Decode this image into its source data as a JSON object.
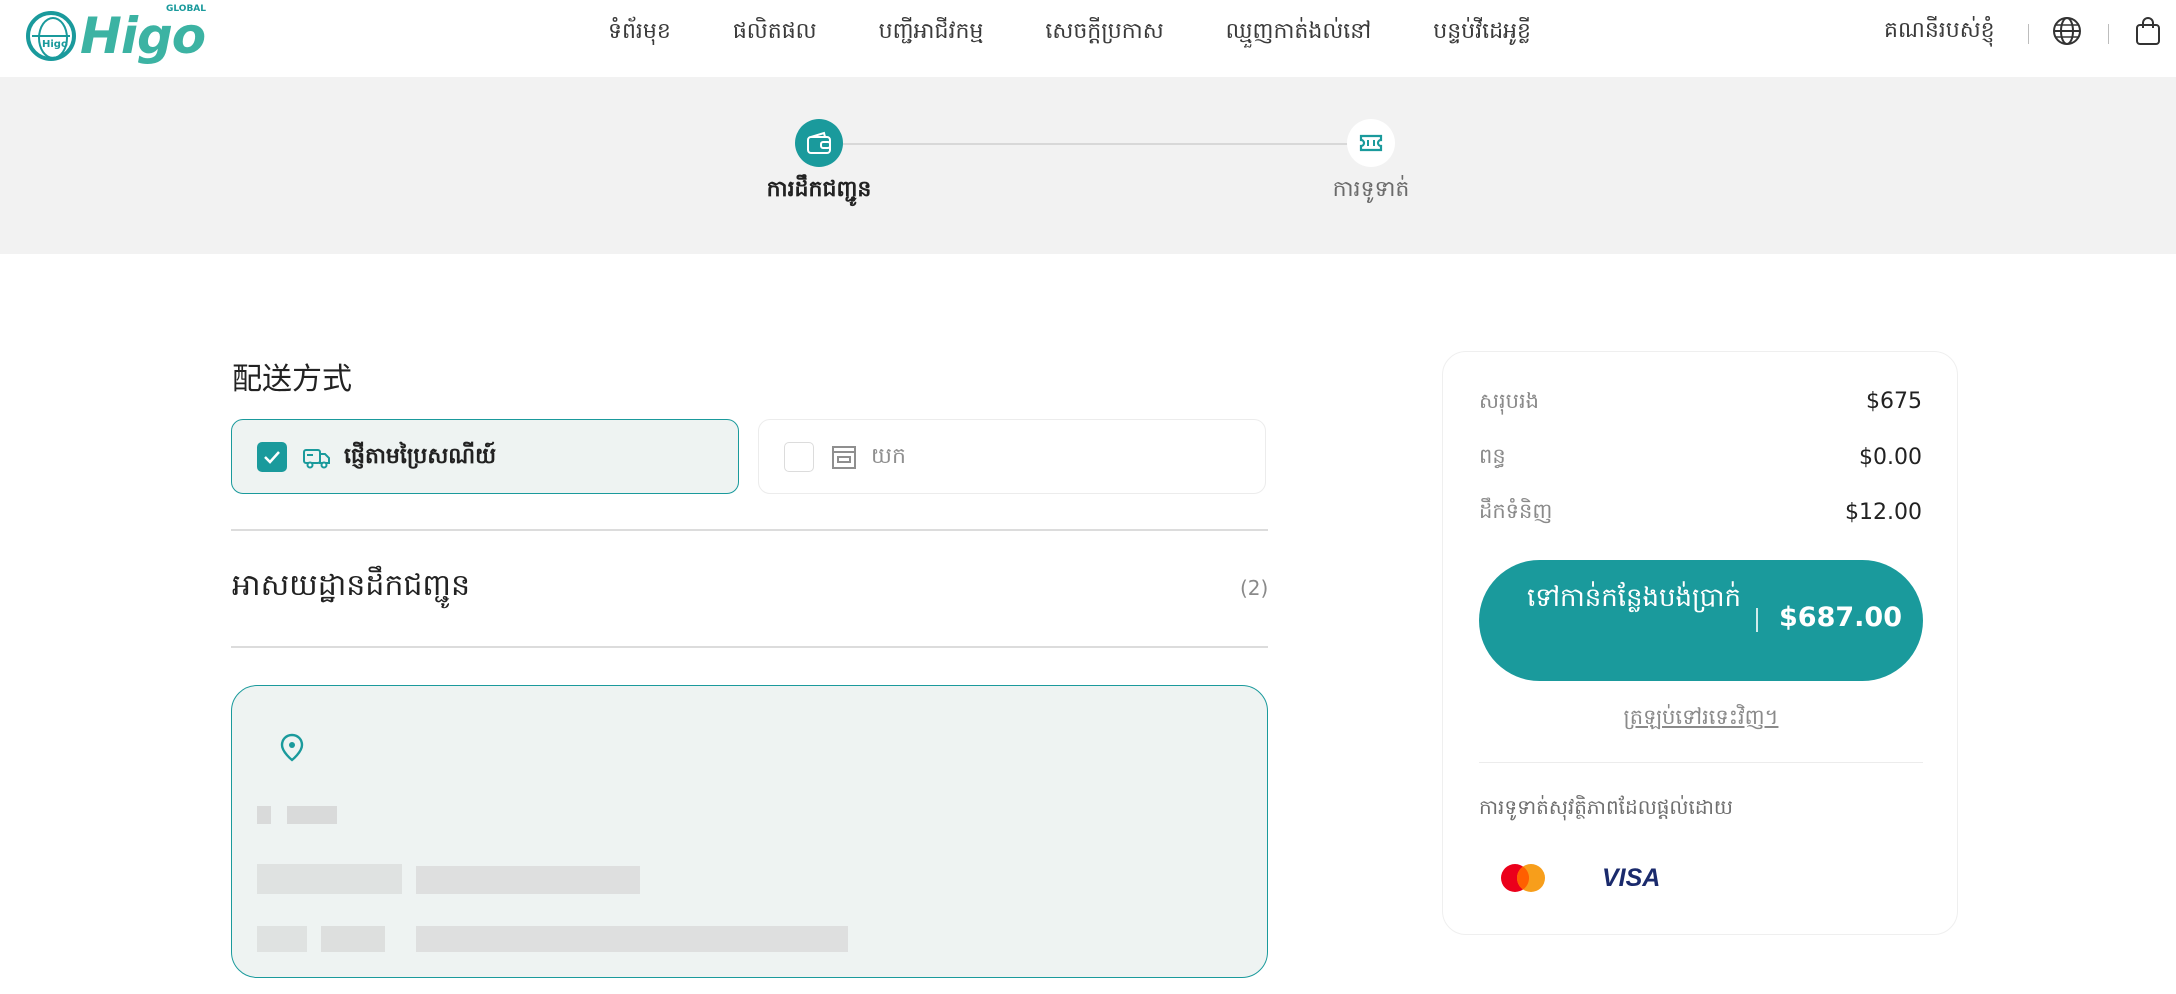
{
  "header": {
    "logo_text": "Higo",
    "logo_sub": "GLOBAL",
    "logo_mark": "Higo",
    "nav": [
      "ទំព័រមុខ",
      "ផលិតផល",
      "បញ្ជីអាជីវកម្ម",
      "សេចក្តីប្រកាស",
      "ឈ្មួញកាត់ងល់នៅ",
      "បន្ទប់វីដេអូខ្លី"
    ],
    "account_label": "គណនីរបស់ខ្ញុំ",
    "icons": [
      "globe-icon",
      "shopping-bag-icon"
    ]
  },
  "stepper": {
    "steps": [
      {
        "label": "ការដឹកជញ្ជូន",
        "state": "active",
        "icon": "wallet-icon"
      },
      {
        "label": "ការទូទាត់",
        "state": "inactive",
        "icon": "ticket-icon"
      }
    ]
  },
  "delivery": {
    "title": "配送方式",
    "options": [
      {
        "label": "ផ្ញើតាមប្រៃសណីយ៍",
        "checked": true,
        "icon": "truck-icon"
      },
      {
        "label": "យក",
        "checked": false,
        "icon": "store-icon"
      }
    ]
  },
  "address": {
    "title": "អាសយដ្ឋានដឹកជញ្ជូន",
    "count": "(2)",
    "icon": "location-pin-icon"
  },
  "summary": {
    "rows": [
      {
        "label": "សរុបរង",
        "value": "$675"
      },
      {
        "label": "ពន្ធ",
        "value": "$0.00"
      },
      {
        "label": "ដឹកទំនិញ",
        "value": "$12.00"
      }
    ],
    "checkout_label": "ទៅកាន់កន្លែងបង់ប្រាក់",
    "checkout_total": "$687.00",
    "back_link": "ត្រឡប់ទៅរទេះវិញ។",
    "secure_text": "ការទូទាត់សុវត្ថិភាពដែលផ្តល់ដោយ",
    "payment_brands": [
      "mastercard",
      "VISA"
    ]
  },
  "colors": {
    "accent": "#1a9a9c",
    "selected_bg": "#eef3f2",
    "stepper_bg": "#f2f2f2"
  }
}
